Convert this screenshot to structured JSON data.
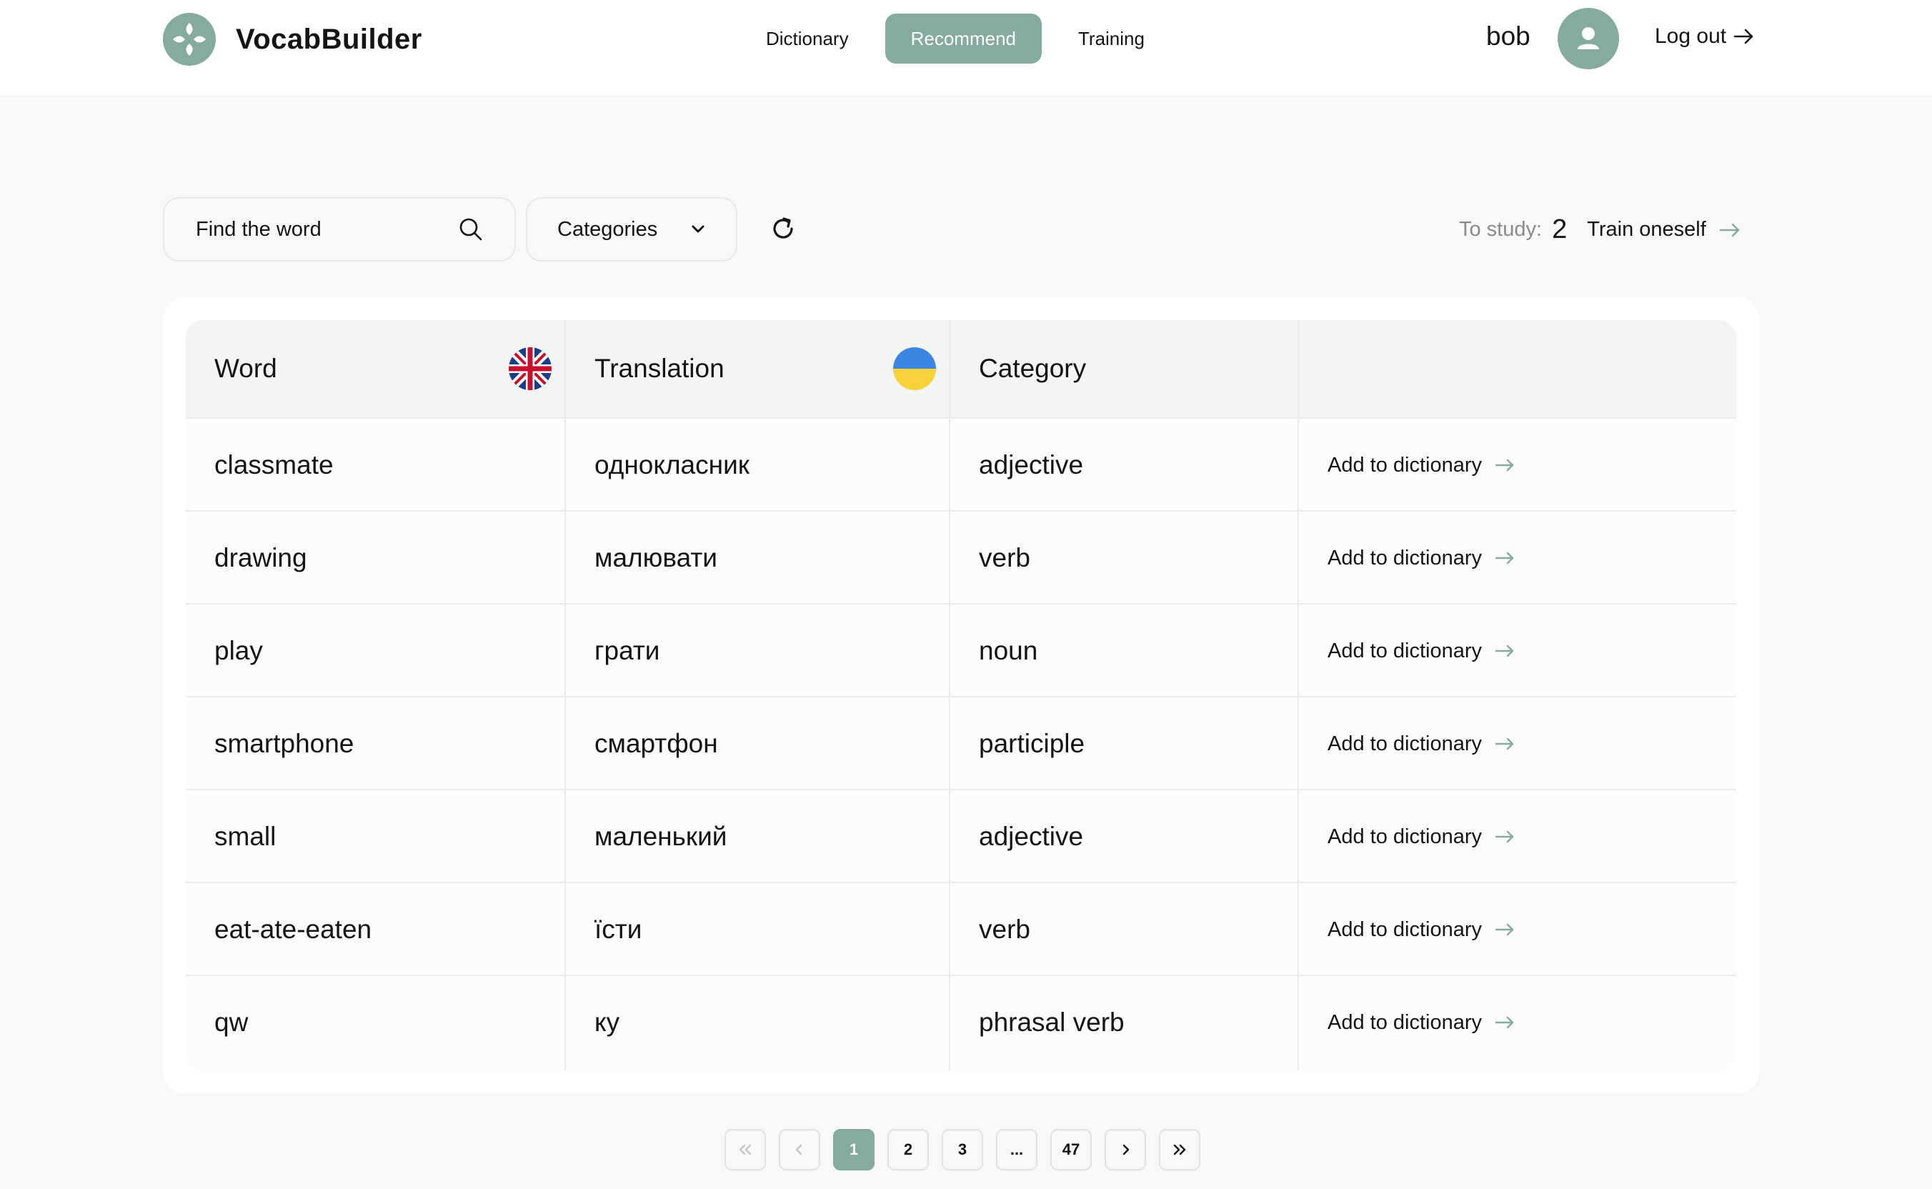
{
  "app": {
    "name": "VocabBuilder"
  },
  "nav": {
    "items": [
      {
        "label": "Dictionary",
        "active": false
      },
      {
        "label": "Recommend",
        "active": true
      },
      {
        "label": "Training",
        "active": false
      }
    ]
  },
  "user": {
    "name": "bob",
    "logout_label": "Log out"
  },
  "toolbar": {
    "search_placeholder": "Find the word",
    "categories_label": "Categories",
    "study_label": "To study:",
    "study_count": "2",
    "train_label": "Train oneself"
  },
  "table": {
    "headers": [
      "Word",
      "Translation",
      "Category",
      ""
    ],
    "action_label": "Add to dictionary",
    "rows": [
      {
        "word": "classmate",
        "translation": "однокласник",
        "category": "adjective"
      },
      {
        "word": "drawing",
        "translation": "малювати",
        "category": "verb"
      },
      {
        "word": "play",
        "translation": "грати",
        "category": "noun"
      },
      {
        "word": "smartphone",
        "translation": "смартфон",
        "category": "participle"
      },
      {
        "word": "small",
        "translation": "маленький",
        "category": "adjective"
      },
      {
        "word": "eat-ate-eaten",
        "translation": "їсти",
        "category": "verb"
      },
      {
        "word": "qw",
        "translation": "ку",
        "category": "phrasal verb"
      }
    ]
  },
  "pagination": {
    "pages": [
      "1",
      "2",
      "3",
      "...",
      "47"
    ],
    "current": "1"
  },
  "colors": {
    "accent": "#85aa9f",
    "background": "#f8f8f7",
    "text": "#121417",
    "muted": "#8a8a89"
  }
}
